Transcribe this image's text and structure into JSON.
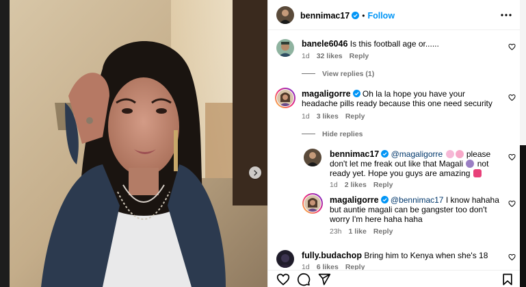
{
  "post": {
    "author": "bennimac17",
    "follow_label": "Follow",
    "separator": "•"
  },
  "comments": [
    {
      "username": "banele6046",
      "text": "Is this football age or......",
      "time": "1d",
      "likes": "32 likes",
      "reply_label": "Reply",
      "view_replies": "View replies (1)"
    },
    {
      "username": "magaligorre",
      "text": "Oh la la hope you have your headache pills ready because this one need security",
      "time": "1d",
      "likes": "3 likes",
      "reply_label": "Reply",
      "hide_replies": "Hide replies",
      "replies": [
        {
          "username": "bennimac17",
          "mention": "@magaligorre",
          "text_a": "please don't let me freak out like that Magali",
          "text_b": "not ready yet. Hope you guys are amazing",
          "time": "1d",
          "likes": "2 likes",
          "reply_label": "Reply"
        },
        {
          "username": "magaligorre",
          "mention": "@bennimac17",
          "text": "I know hahaha but auntie magali can be gangster too don't worry I'm here haha haha",
          "time": "23h",
          "likes": "1 like",
          "reply_label": "Reply"
        }
      ]
    },
    {
      "username": "fully.budachop",
      "text": "Bring him to Kenya when she's 18",
      "time": "1d",
      "likes": "6 likes",
      "reply_label": "Reply"
    }
  ],
  "icons": {
    "verified": "verified-badge-icon",
    "heart": "heart-outline-icon",
    "more": "more-horizontal-icon",
    "next": "chevron-right-icon",
    "like": "heart-icon",
    "comment": "comment-icon",
    "share": "send-icon",
    "save": "bookmark-icon"
  },
  "colors": {
    "accent": "#0095f6",
    "verified": "#0095f6",
    "meta": "#737373",
    "mention": "#00376b"
  }
}
